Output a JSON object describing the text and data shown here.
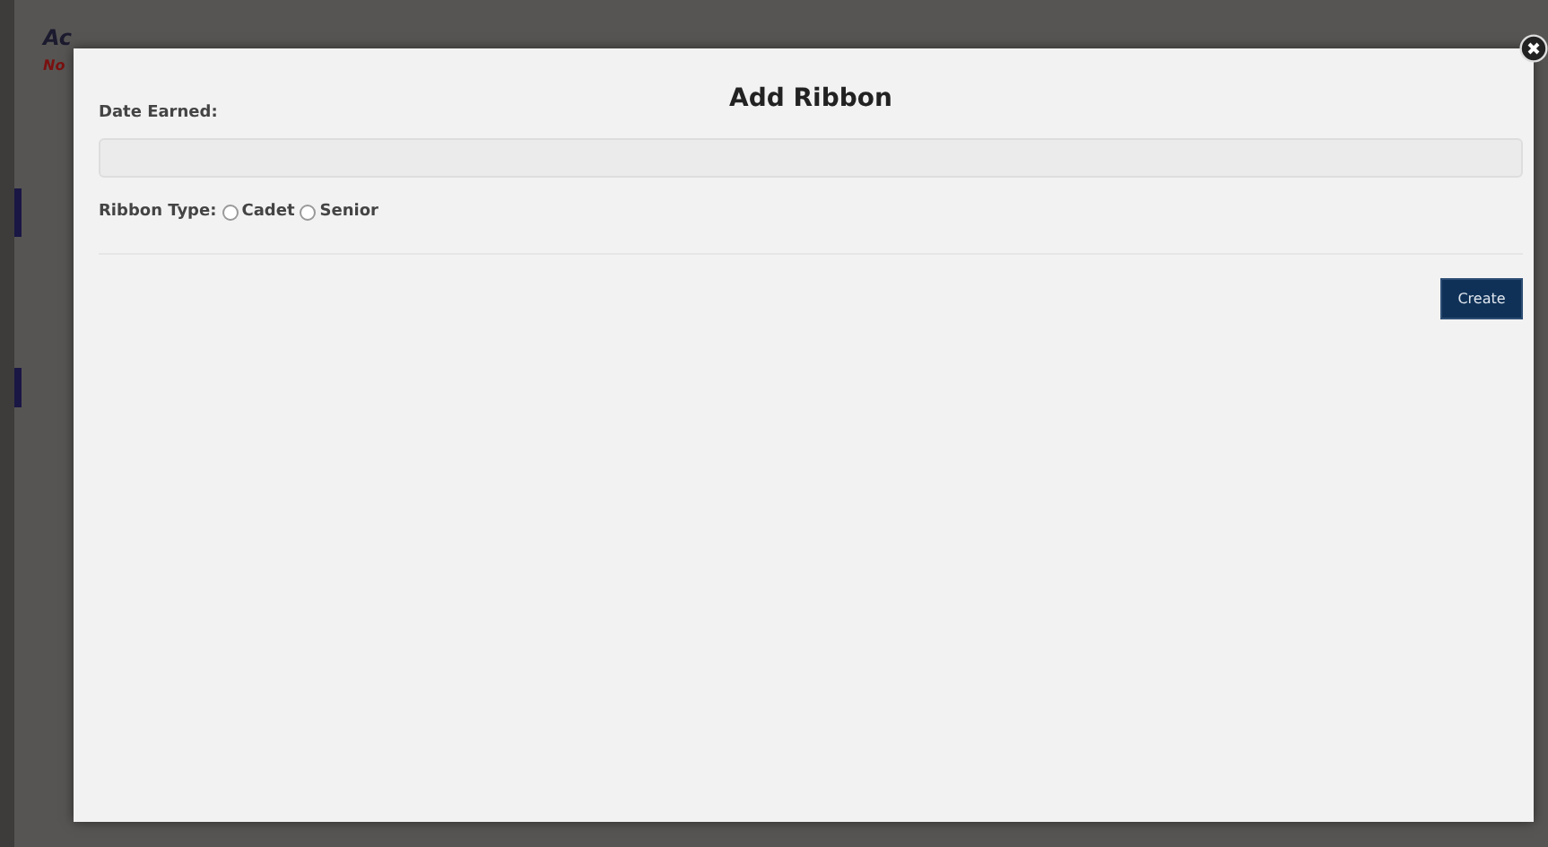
{
  "background_page": {
    "heading": "Ac",
    "notice": "No"
  },
  "dialog": {
    "title": "Add Ribbon",
    "date_field": {
      "label": "Date Earned:"
    },
    "ribbon_type": {
      "label": "Ribbon Type:",
      "options": [
        {
          "label": "Cadet",
          "selected": false
        },
        {
          "label": "Senior",
          "selected": false
        }
      ]
    },
    "buttons": [
      "Create"
    ]
  }
}
